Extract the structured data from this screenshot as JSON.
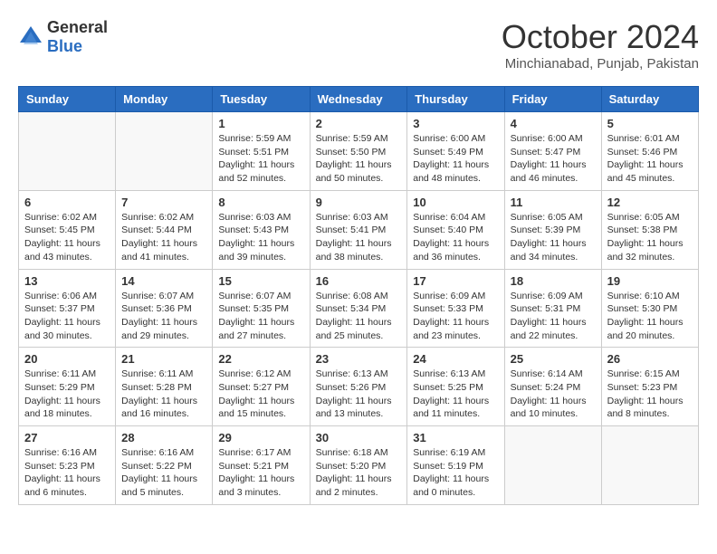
{
  "logo": {
    "general": "General",
    "blue": "Blue"
  },
  "title": "October 2024",
  "location": "Minchianabad, Punjab, Pakistan",
  "days_header": [
    "Sunday",
    "Monday",
    "Tuesday",
    "Wednesday",
    "Thursday",
    "Friday",
    "Saturday"
  ],
  "weeks": [
    [
      {
        "day": "",
        "info": ""
      },
      {
        "day": "",
        "info": ""
      },
      {
        "day": "1",
        "info": "Sunrise: 5:59 AM\nSunset: 5:51 PM\nDaylight: 11 hours\nand 52 minutes."
      },
      {
        "day": "2",
        "info": "Sunrise: 5:59 AM\nSunset: 5:50 PM\nDaylight: 11 hours\nand 50 minutes."
      },
      {
        "day": "3",
        "info": "Sunrise: 6:00 AM\nSunset: 5:49 PM\nDaylight: 11 hours\nand 48 minutes."
      },
      {
        "day": "4",
        "info": "Sunrise: 6:00 AM\nSunset: 5:47 PM\nDaylight: 11 hours\nand 46 minutes."
      },
      {
        "day": "5",
        "info": "Sunrise: 6:01 AM\nSunset: 5:46 PM\nDaylight: 11 hours\nand 45 minutes."
      }
    ],
    [
      {
        "day": "6",
        "info": "Sunrise: 6:02 AM\nSunset: 5:45 PM\nDaylight: 11 hours\nand 43 minutes."
      },
      {
        "day": "7",
        "info": "Sunrise: 6:02 AM\nSunset: 5:44 PM\nDaylight: 11 hours\nand 41 minutes."
      },
      {
        "day": "8",
        "info": "Sunrise: 6:03 AM\nSunset: 5:43 PM\nDaylight: 11 hours\nand 39 minutes."
      },
      {
        "day": "9",
        "info": "Sunrise: 6:03 AM\nSunset: 5:41 PM\nDaylight: 11 hours\nand 38 minutes."
      },
      {
        "day": "10",
        "info": "Sunrise: 6:04 AM\nSunset: 5:40 PM\nDaylight: 11 hours\nand 36 minutes."
      },
      {
        "day": "11",
        "info": "Sunrise: 6:05 AM\nSunset: 5:39 PM\nDaylight: 11 hours\nand 34 minutes."
      },
      {
        "day": "12",
        "info": "Sunrise: 6:05 AM\nSunset: 5:38 PM\nDaylight: 11 hours\nand 32 minutes."
      }
    ],
    [
      {
        "day": "13",
        "info": "Sunrise: 6:06 AM\nSunset: 5:37 PM\nDaylight: 11 hours\nand 30 minutes."
      },
      {
        "day": "14",
        "info": "Sunrise: 6:07 AM\nSunset: 5:36 PM\nDaylight: 11 hours\nand 29 minutes."
      },
      {
        "day": "15",
        "info": "Sunrise: 6:07 AM\nSunset: 5:35 PM\nDaylight: 11 hours\nand 27 minutes."
      },
      {
        "day": "16",
        "info": "Sunrise: 6:08 AM\nSunset: 5:34 PM\nDaylight: 11 hours\nand 25 minutes."
      },
      {
        "day": "17",
        "info": "Sunrise: 6:09 AM\nSunset: 5:33 PM\nDaylight: 11 hours\nand 23 minutes."
      },
      {
        "day": "18",
        "info": "Sunrise: 6:09 AM\nSunset: 5:31 PM\nDaylight: 11 hours\nand 22 minutes."
      },
      {
        "day": "19",
        "info": "Sunrise: 6:10 AM\nSunset: 5:30 PM\nDaylight: 11 hours\nand 20 minutes."
      }
    ],
    [
      {
        "day": "20",
        "info": "Sunrise: 6:11 AM\nSunset: 5:29 PM\nDaylight: 11 hours\nand 18 minutes."
      },
      {
        "day": "21",
        "info": "Sunrise: 6:11 AM\nSunset: 5:28 PM\nDaylight: 11 hours\nand 16 minutes."
      },
      {
        "day": "22",
        "info": "Sunrise: 6:12 AM\nSunset: 5:27 PM\nDaylight: 11 hours\nand 15 minutes."
      },
      {
        "day": "23",
        "info": "Sunrise: 6:13 AM\nSunset: 5:26 PM\nDaylight: 11 hours\nand 13 minutes."
      },
      {
        "day": "24",
        "info": "Sunrise: 6:13 AM\nSunset: 5:25 PM\nDaylight: 11 hours\nand 11 minutes."
      },
      {
        "day": "25",
        "info": "Sunrise: 6:14 AM\nSunset: 5:24 PM\nDaylight: 11 hours\nand 10 minutes."
      },
      {
        "day": "26",
        "info": "Sunrise: 6:15 AM\nSunset: 5:23 PM\nDaylight: 11 hours\nand 8 minutes."
      }
    ],
    [
      {
        "day": "27",
        "info": "Sunrise: 6:16 AM\nSunset: 5:23 PM\nDaylight: 11 hours\nand 6 minutes."
      },
      {
        "day": "28",
        "info": "Sunrise: 6:16 AM\nSunset: 5:22 PM\nDaylight: 11 hours\nand 5 minutes."
      },
      {
        "day": "29",
        "info": "Sunrise: 6:17 AM\nSunset: 5:21 PM\nDaylight: 11 hours\nand 3 minutes."
      },
      {
        "day": "30",
        "info": "Sunrise: 6:18 AM\nSunset: 5:20 PM\nDaylight: 11 hours\nand 2 minutes."
      },
      {
        "day": "31",
        "info": "Sunrise: 6:19 AM\nSunset: 5:19 PM\nDaylight: 11 hours\nand 0 minutes."
      },
      {
        "day": "",
        "info": ""
      },
      {
        "day": "",
        "info": ""
      }
    ]
  ]
}
